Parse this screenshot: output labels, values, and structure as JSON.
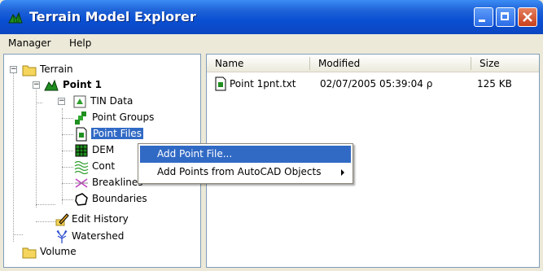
{
  "window": {
    "title": "Terrain Model Explorer"
  },
  "menubar": {
    "items": [
      "Manager",
      "Help"
    ]
  },
  "tree": {
    "root": "Terrain",
    "point1": "Point 1",
    "tin_data": "TIN Data",
    "point_groups": "Point Groups",
    "point_files": "Point Files",
    "dem": "DEM",
    "contours": "Cont",
    "breaklines": "Breaklines",
    "boundaries": "Boundaries",
    "edit_history": "Edit History",
    "watershed": "Watershed",
    "volume": "Volume"
  },
  "list": {
    "columns": [
      "Name",
      "Modified",
      "Size"
    ],
    "rows": [
      {
        "name": "Point 1pnt.txt",
        "modified": "02/07/2005 05:39:04 ρ",
        "size": "125 KB"
      }
    ]
  },
  "context_menu": {
    "items": [
      "Add Point File...",
      "Add Points from AutoCAD Objects"
    ]
  },
  "colors": {
    "title_blue": "#0a4fd3",
    "selection": "#316ac5",
    "folder_yellow": "#f5d55b",
    "green_icon": "#1f8f1f"
  }
}
